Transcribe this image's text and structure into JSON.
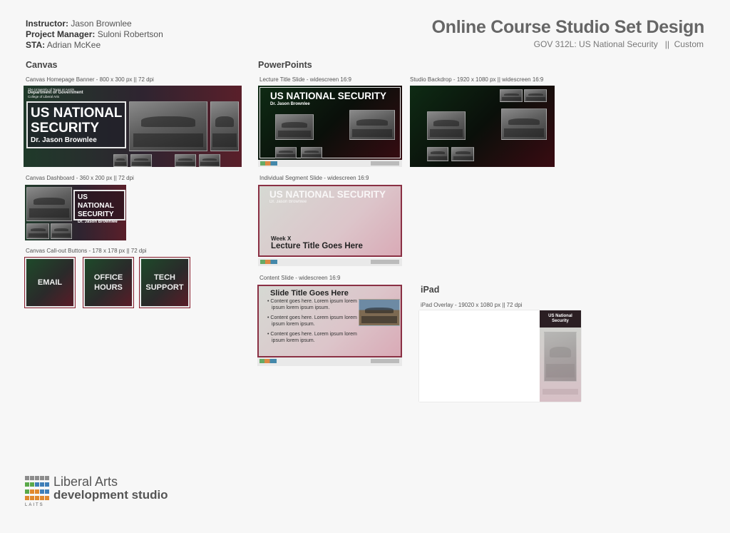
{
  "meta": {
    "instructor_label": "Instructor:",
    "instructor": "Jason Brownlee",
    "pm_label": "Project Manager:",
    "pm": "Suloni Robertson",
    "sta_label": "STA:",
    "sta": "Adrian McKee"
  },
  "title": "Online Course Studio Set Design",
  "subtitle": "GOV 312L: US National Security   ||  Custom",
  "sections": {
    "canvas": "Canvas",
    "powerpoints": "PowerPoints",
    "ipad": "iPad"
  },
  "captions": {
    "banner": "Canvas Homepage Banner - 800 x 300 px || 72 dpi",
    "dashboard": "Canvas Dashboard - 360 x 200 px || 72 dpi",
    "callout": "Canvas Call-out Buttons - 178 x 178 px || 72 dpi",
    "lecture": "Lecture Title Slide - widescreen 16:9",
    "backdrop": "Studio Backdrop - 1920 x 1080 px || widescreen 16:9",
    "segment": "Individual Segment Slide - widescreen 16:9",
    "content": "Content Slide - widescreen 16:9",
    "ipad": "iPad Overlay - 19020 x 1080 px || 72 dpi"
  },
  "banner": {
    "univ_line1": "The University of Texas at Austin",
    "univ_line2": "Department of Government",
    "univ_line3": "College of Liberal Arts",
    "title_line1": "US NATIONAL",
    "title_line2": "SECURITY",
    "name": "Dr. Jason Brownlee"
  },
  "dashboard": {
    "title_line1": "US NATIONAL",
    "title_line2": "SECURITY",
    "name": "Dr. Jason Brownlee"
  },
  "buttons": {
    "email": "EMAIL",
    "office1": "OFFICE",
    "office2": "HOURS",
    "tech1": "TECH",
    "tech2": "SUPPORT"
  },
  "lecture": {
    "title": "US NATIONAL SECURITY",
    "name": "Dr. Jason Brownlee"
  },
  "segment": {
    "title": "US NATIONAL SECURITY",
    "name": "Dr. Jason Brownlee",
    "week": "Week X",
    "lecture_title": "Lecture Title Goes Here"
  },
  "content": {
    "title": "Slide Title Goes Here",
    "bullets": [
      "Content goes here. Lorem ipsum lorem ipsum lorem ipsum ipsum.",
      "Content goes here. Lorem ipsum lorem ipsum lorem ipsum.",
      "Content goes here. Lorem ipsum lorem ipsum lorem ipsum."
    ]
  },
  "ipad": {
    "title_line1": "US National",
    "title_line2": "Security"
  },
  "footer": {
    "line1": "Liberal Arts",
    "line2": "development studio",
    "line3": "LAITS"
  },
  "colors": {
    "accent_green": "#1e4a2a",
    "accent_red": "#5a1c28"
  }
}
